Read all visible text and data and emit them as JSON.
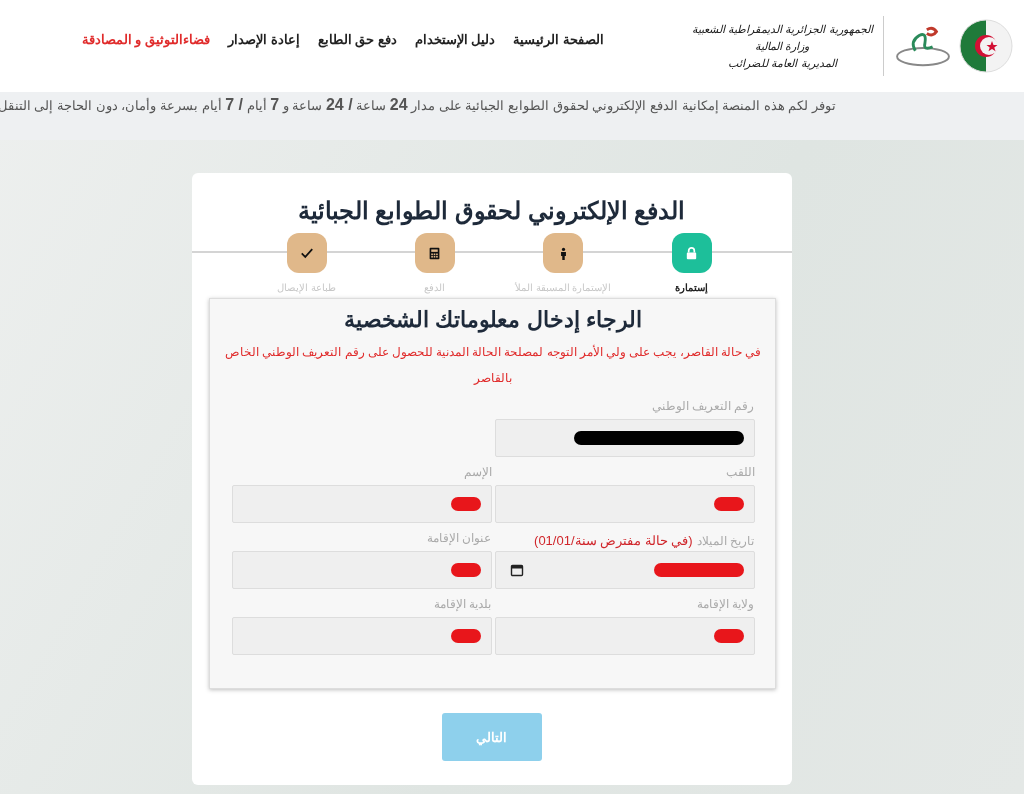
{
  "logo": {
    "lines": [
      "الجمهورية الجزائرية الديمقراطية الشعبية",
      "وزارة المالية",
      "المديرية العامة للضرائب"
    ]
  },
  "nav": [
    {
      "label": "الصفحة الرئيسية",
      "highlighted": false
    },
    {
      "label": "دليل الإستخدام",
      "highlighted": false
    },
    {
      "label": "دفع حق الطابع",
      "highlighted": false
    },
    {
      "label": "إعادة الإصدار",
      "highlighted": false
    },
    {
      "label": "فضاءالتوثيق و المصادقة",
      "highlighted": true
    }
  ],
  "banner": "توفر لكم هذه المنصة إمكانية الدفع الإلكتروني لحقوق الطوابع الجبائية على مدار **24** ساعة **/ 24** ساعة و **7** أيام **/ 7** أيام بسرعة وأمان، دون الحاجة إلى التنقل",
  "card": {
    "title": "الدفع الإلكتروني لحقوق الطوابع الجبائية",
    "steps": [
      {
        "label": "إستمارة",
        "selected": true
      },
      {
        "label": "الإستمارة المسبقة الملأ",
        "selected": false
      },
      {
        "label": "الدفع",
        "selected": false
      },
      {
        "label": "طباعة الإيصال",
        "selected": false
      }
    ],
    "form": {
      "heading": "الرجاء إدخال معلوماتك الشخصية",
      "notice": "في حالة القاصر، يجب على ولي الأمر التوجه لمصلحة الحالة المدنية للحصول على رقم التعريف الوطني الخاص بالقاصر",
      "fields": [
        {
          "label": "رقم التعريف الوطني",
          "kind": "solo",
          "color": "#000000"
        },
        {
          "label": "اللقب",
          "kind": "text",
          "color": "#e8161b"
        },
        {
          "label": "الإسم",
          "kind": "text",
          "color": "#e8161b"
        },
        {
          "label": "تاريخ الميلاد",
          "note": "(في حالة مفترض سنة/01/01)",
          "kind": "date",
          "color": "#e8161b"
        },
        {
          "label": "عنوان الإقامة",
          "kind": "text",
          "color": "#e8161b"
        },
        {
          "label": "ولاية الإقامة",
          "kind": "text",
          "color": "#e8161b"
        },
        {
          "label": "بلدية الإقامة",
          "kind": "text",
          "color": "#e8161b"
        }
      ]
    },
    "next_button": {
      "label": "التالي",
      "disabled": true
    }
  }
}
